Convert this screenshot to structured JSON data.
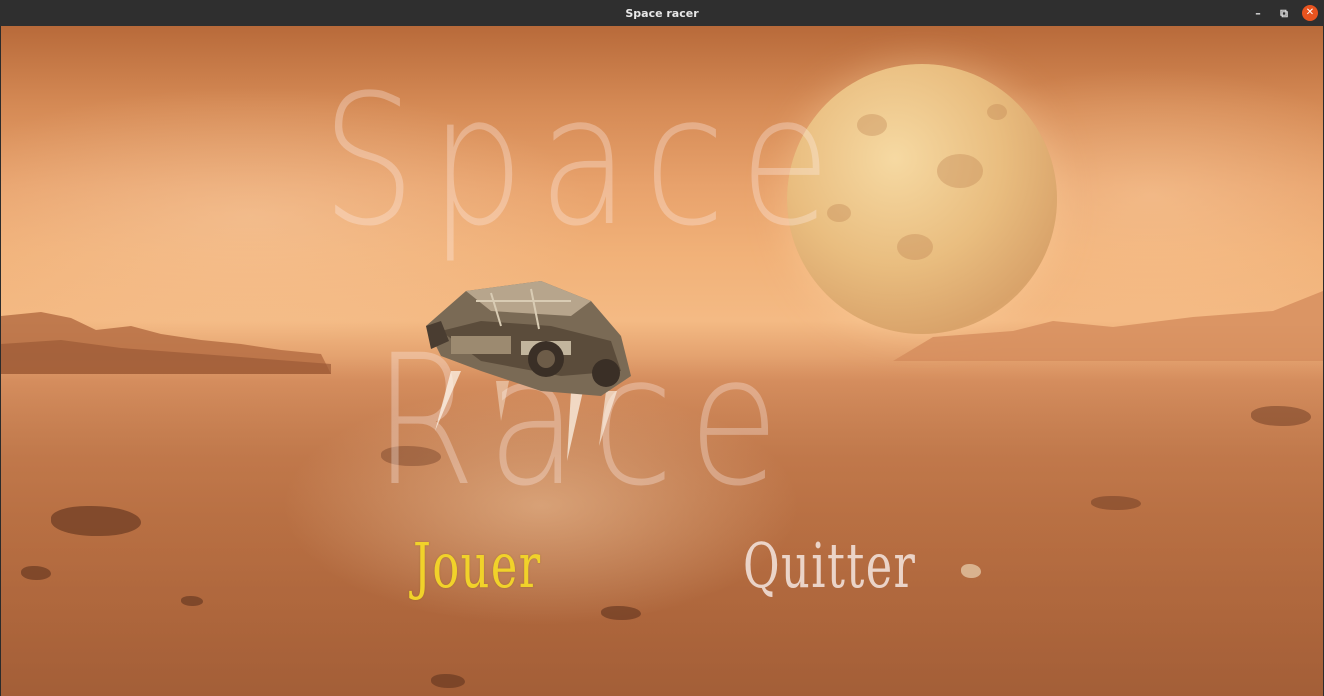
{
  "window": {
    "title": "Space racer",
    "controls": {
      "minimize": "–",
      "maximize": "⧉",
      "close": "✕"
    }
  },
  "game": {
    "title": "Space Race",
    "menu": {
      "play_label": "Jouer",
      "quit_label": "Quitter"
    }
  },
  "colors": {
    "titlebar": "#2f2f2f",
    "play": "#f1d22a",
    "quit": "#f5e6e1",
    "close_button": "#e9541f"
  }
}
